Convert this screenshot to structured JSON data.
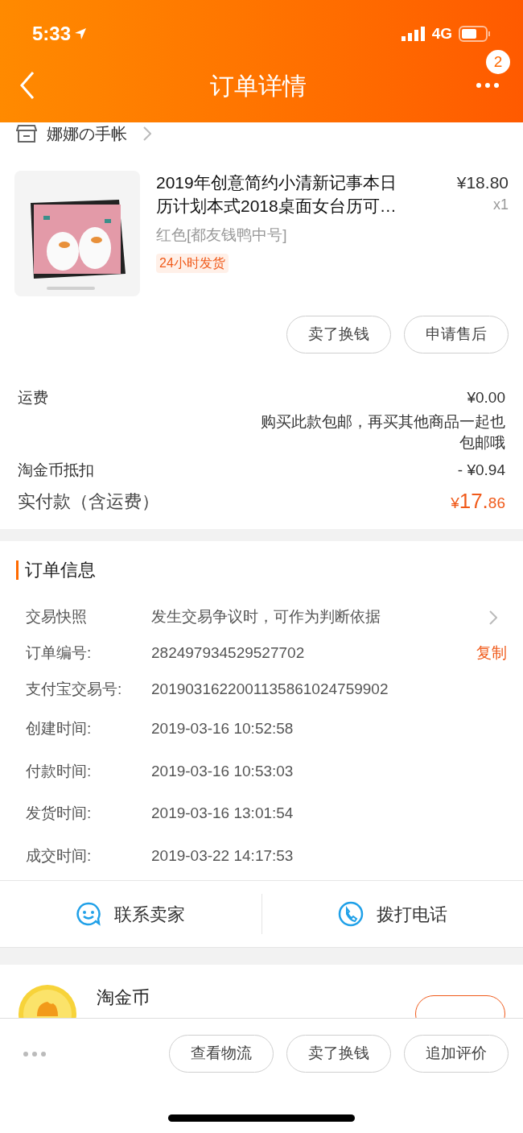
{
  "status_bar": {
    "time": "5:33",
    "network": "4G"
  },
  "nav": {
    "title": "订单详情",
    "badge": "2"
  },
  "shop": {
    "name": "娜娜の手帐"
  },
  "product": {
    "kind": "picture",
    "title": "2019年创意简约小清新记事本日历计划本式2018桌面女台历可…",
    "price": "¥18.80",
    "quantity": "x1",
    "sku": "红色[都友钱鸭中号]",
    "tag": "24小时发货"
  },
  "item_actions": [
    "卖了换钱",
    "申请售后"
  ],
  "fees": [
    {
      "label": "运费",
      "value": "¥0.00",
      "note": "购买此款包邮，再买其他商品一起也包邮哦"
    },
    {
      "label": "淘金币抵扣",
      "value": "- ¥0.94"
    }
  ],
  "total": {
    "label": "实付款（含运费）",
    "currency": "¥",
    "integer": "17.",
    "decimal": "86"
  },
  "order_info": {
    "title": "订单信息",
    "rows": [
      {
        "kind": "link",
        "label": "交易快照",
        "value": "发生交易争议时，可作为判断依据"
      },
      {
        "kind": "copy",
        "label": "订单编号:",
        "value": "282497934529527702",
        "action": "复制"
      },
      {
        "kind": "plain",
        "label": "支付宝交易号:",
        "value": "2019031622001135861024759902"
      },
      {
        "kind": "plain",
        "label": "创建时间:",
        "value": "2019-03-16 10:52:58"
      },
      {
        "kind": "plain",
        "label": "付款时间:",
        "value": "2019-03-16 10:53:03"
      },
      {
        "kind": "plain",
        "label": "发货时间:",
        "value": "2019-03-16 13:01:54"
      },
      {
        "kind": "plain",
        "label": "成交时间:",
        "value": "2019-03-22 14:17:53"
      }
    ]
  },
  "contact": [
    {
      "kind": "chat",
      "label": "联系卖家"
    },
    {
      "kind": "phone",
      "label": "拨打电话"
    }
  ],
  "coins": {
    "title": "淘金币"
  },
  "bottom_actions": [
    "查看物流",
    "卖了换钱",
    "追加评价"
  ]
}
